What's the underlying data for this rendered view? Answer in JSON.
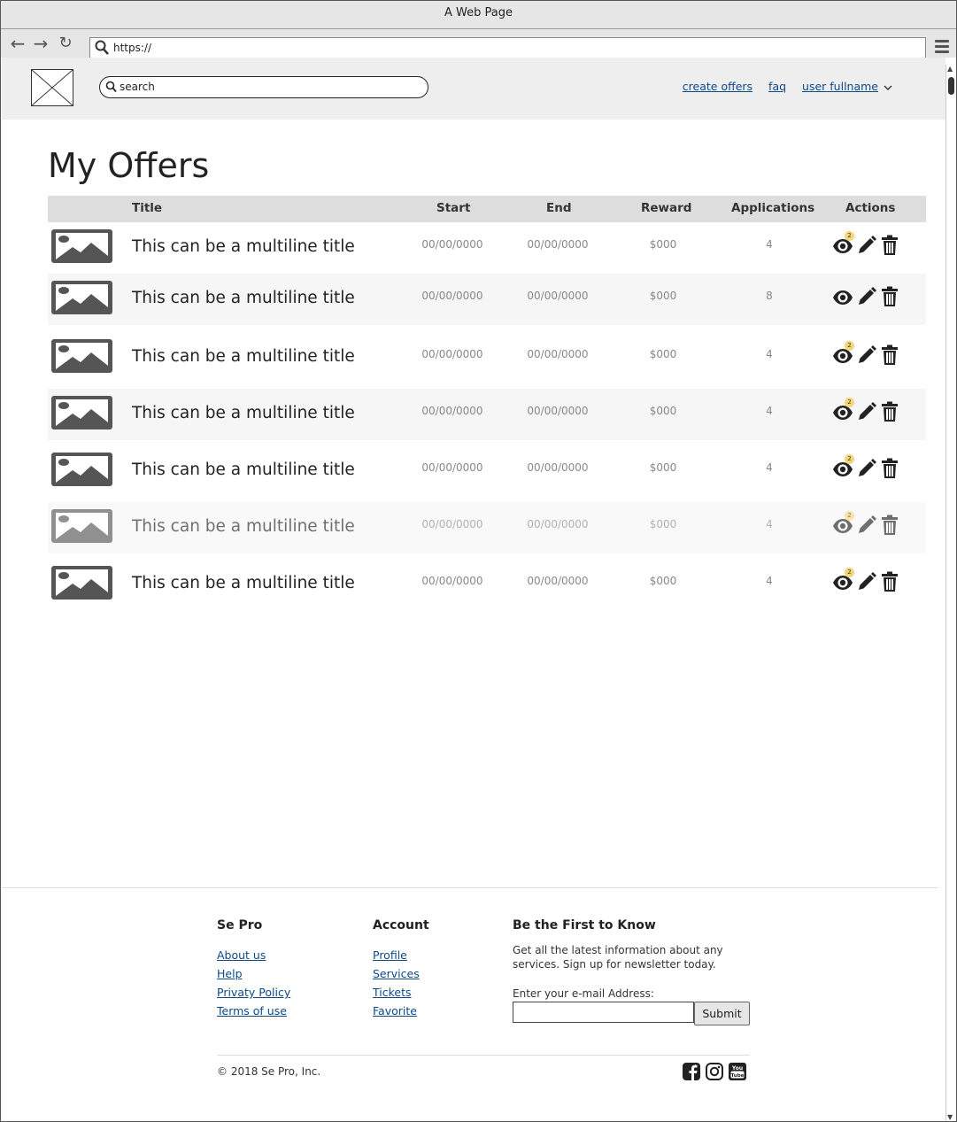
{
  "window": {
    "title": "A Web Page"
  },
  "addressbar": {
    "url": "https://"
  },
  "header": {
    "search_placeholder": "search",
    "links": {
      "create_offers": "create offers",
      "faq": "faq",
      "user": "user fullname"
    }
  },
  "page": {
    "title": "My Offers"
  },
  "table": {
    "columns": {
      "title": "Title",
      "start": "Start",
      "end": "End",
      "reward": "Reward",
      "applications": "Applications",
      "actions": "Actions"
    },
    "rows": [
      {
        "title": "This can be a multiline title",
        "start": "00/00/0000",
        "end": "00/00/0000",
        "reward": "$000",
        "applications": "4",
        "badge": "2"
      },
      {
        "title": "This can be a multiline title",
        "start": "00/00/0000",
        "end": "00/00/0000",
        "reward": "$000",
        "applications": "8",
        "badge": ""
      },
      {
        "title": "This can be a multiline title",
        "start": "00/00/0000",
        "end": "00/00/0000",
        "reward": "$000",
        "applications": "4",
        "badge": "2"
      },
      {
        "title": "This can be a multiline title",
        "start": "00/00/0000",
        "end": "00/00/0000",
        "reward": "$000",
        "applications": "4",
        "badge": "2"
      },
      {
        "title": "This can be a multiline title",
        "start": "00/00/0000",
        "end": "00/00/0000",
        "reward": "$000",
        "applications": "4",
        "badge": "2"
      },
      {
        "title": "This can be a multiline title",
        "start": "00/00/0000",
        "end": "00/00/0000",
        "reward": "$000",
        "applications": "4",
        "badge": "2"
      },
      {
        "title": "This can be a multiline title",
        "start": "00/00/0000",
        "end": "00/00/0000",
        "reward": "$000",
        "applications": "4",
        "badge": "2"
      }
    ]
  },
  "footer": {
    "col1": {
      "heading": "Se Pro",
      "links": [
        "About us",
        "Help",
        "Privaty Policy",
        "Terms of use"
      ]
    },
    "col2": {
      "heading": "Account",
      "links": [
        "Profile",
        "Services",
        "Tickets",
        "Favorite"
      ]
    },
    "newsletter": {
      "heading": "Be the First to Know",
      "text": "Get all the latest information about any services. Sign up for newsletter today.",
      "label": "Enter your e-mail Address:",
      "submit": "Submit"
    },
    "copyright": "© 2018 Se Pro, Inc.",
    "social_icons": [
      "facebook-icon",
      "instagram-icon",
      "youtube-icon"
    ]
  },
  "colors": {
    "link": "#0c4a8a",
    "badge": "#f3d77a",
    "header_bg": "#eeeeee",
    "table_head_bg": "#dddddd"
  }
}
